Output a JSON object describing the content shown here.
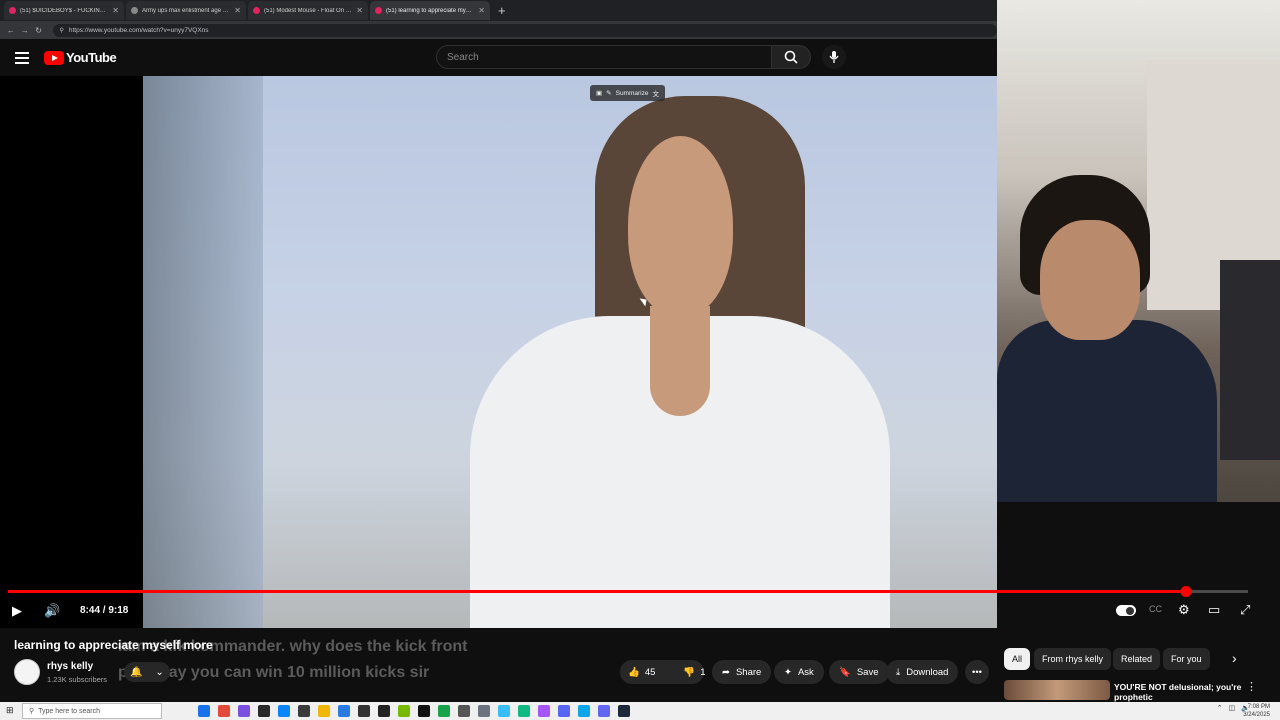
{
  "browser": {
    "tabs": [
      {
        "title": "(51) $UICIDEBOY$ - FUCKING YOU",
        "active": false
      },
      {
        "title": "Army ups max enlistment age to 4",
        "active": false
      },
      {
        "title": "(51) Modest Mouse - Float On [Of",
        "active": false
      },
      {
        "title": "(51) learning to appreciate myself",
        "active": true
      }
    ],
    "new_tab": "+",
    "url": "https://www.youtube.com/watch?v=unyy7VQXns"
  },
  "youtube": {
    "logo_text": "YouTube",
    "search_placeholder": "Search",
    "player": {
      "summarize_label": "Summarize",
      "time": "8:44 / 9:18",
      "progress": 0.95
    },
    "video": {
      "title": "learning to appreciate myself more",
      "chat_overlay": "iam a kfk kommander. why does the kick front page say you can win 10 million kicks sir",
      "channel": "rhys kelly",
      "subscribers": "1.23K subscribers",
      "likes": "45",
      "dislikes": "1",
      "share": "Share",
      "ask": "Ask",
      "save": "Save",
      "download": "Download",
      "more": "•••"
    },
    "chips": [
      {
        "label": "All",
        "selected": true
      },
      {
        "label": "From rhys kelly",
        "selected": false
      },
      {
        "label": "Related",
        "selected": false
      },
      {
        "label": "For you",
        "selected": false
      }
    ],
    "recommended": {
      "title": "YOU'RE NOT delusional; you're prophetic"
    }
  },
  "taskbar": {
    "search_placeholder": "Type here to search",
    "time": "7:08 PM",
    "date": "3/24/2025"
  },
  "colors": {
    "accent": "#ff0000",
    "background": "#0f0f0f"
  }
}
